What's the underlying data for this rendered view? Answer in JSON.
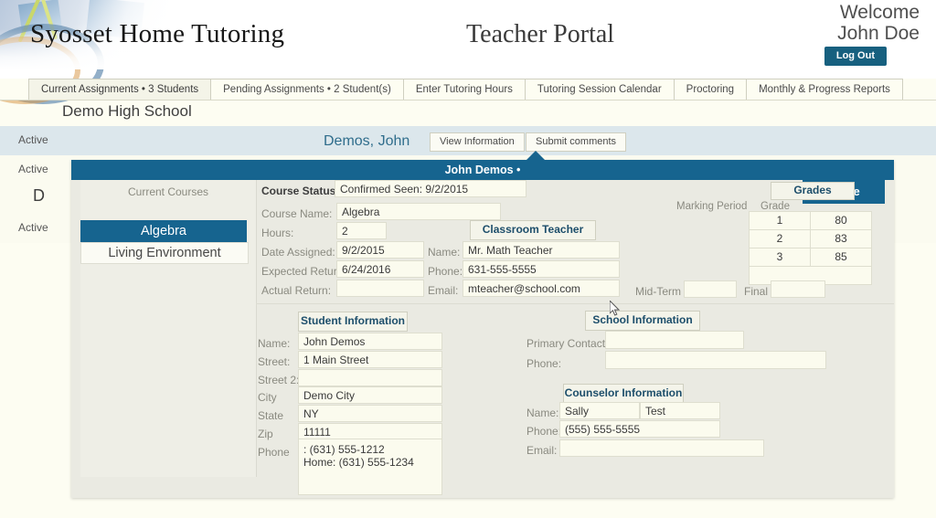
{
  "header": {
    "brand": "Syosset Home Tutoring",
    "portal_title": "Teacher Portal",
    "welcome_line1": "Welcome",
    "welcome_line2": "John Doe",
    "logout_label": "Log Out"
  },
  "nav": {
    "tabs": [
      {
        "label": "Current Assignments • 3 Students",
        "active": true
      },
      {
        "label": "Pending Assignments • 2 Student(s)",
        "active": false
      },
      {
        "label": "Enter Tutoring Hours",
        "active": false
      },
      {
        "label": "Tutoring Session Calendar",
        "active": false
      },
      {
        "label": "Proctoring",
        "active": false
      },
      {
        "label": "Monthly & Progress  Reports",
        "active": false
      }
    ]
  },
  "list": {
    "school_name": "Demo High School",
    "partial_text": "D",
    "rows": [
      {
        "status": "Active"
      },
      {
        "status": "Active"
      },
      {
        "status": "Active"
      }
    ],
    "selected_student": "Demos, John",
    "view_information_label": "View Information",
    "submit_comments_label": "Submit comments"
  },
  "modal": {
    "title": "John Demos •",
    "close_label": "Close",
    "courses_title": "Current Courses",
    "courses": [
      {
        "label": "Algebra",
        "selected": true
      },
      {
        "label": "Living Environment",
        "selected": false
      }
    ],
    "course_status_label": "Course Status:",
    "course_status_value": "Confirmed Seen: 9/2/2015",
    "course_name_label": "Course Name:",
    "course_name_value": "Algebra",
    "hours_label": "Hours:",
    "hours_value": "2",
    "date_assigned_label": "Date Assigned:",
    "date_assigned_value": "9/2/2015",
    "expected_return_label": "Expected Return:",
    "expected_return_value": "6/24/2016",
    "actual_return_label": "Actual Return:",
    "actual_return_value": "",
    "classroom_teacher_label": "Classroom Teacher",
    "teacher_name_label": "Name:",
    "teacher_name_value": "Mr. Math Teacher",
    "teacher_phone_label": "Phone:",
    "teacher_phone_value": "631-555-5555",
    "teacher_email_label": "Email:",
    "teacher_email_value": "mteacher@school.com",
    "grades_label": "Grades",
    "marking_period_header": "Marking Period",
    "grade_header": "Grade",
    "grades": [
      {
        "period": "1",
        "grade": "80"
      },
      {
        "period": "2",
        "grade": "83"
      },
      {
        "period": "3",
        "grade": "85"
      }
    ],
    "midterm_label": "Mid-Term",
    "midterm_value": "",
    "final_label": "Final",
    "final_value": "",
    "student_info_label": "Student Information",
    "student": {
      "name_label": "Name:",
      "name_value": "John  Demos",
      "street_label": "Street:",
      "street_value": "1 Main Street",
      "street2_label": "Street 2:",
      "street2_value": "",
      "city_label": "City",
      "city_value": "Demo City",
      "state_label": "State",
      "state_value": "NY",
      "zip_label": "Zip",
      "zip_value": "11111",
      "phone_label": "Phone",
      "phone_value": ":  (631) 555-1212\nHome:  (631) 555-1234"
    },
    "school_info_label": "School Information",
    "school": {
      "primary_contact_label": "Primary Contact:",
      "primary_contact_value": "",
      "phone_label": "Phone:",
      "phone_value": ""
    },
    "counselor_info_label": "Counselor Information",
    "counselor": {
      "name_label": "Name:",
      "first_name_value": "Sally",
      "last_name_value": "Test",
      "phone_label": "Phone:",
      "phone_value": "(555) 555-5555",
      "email_label": "Email:",
      "email_value": ""
    }
  }
}
